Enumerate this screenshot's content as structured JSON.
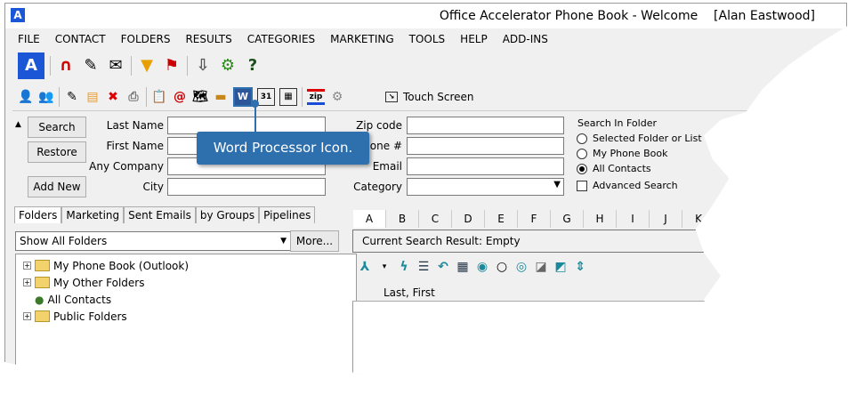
{
  "window": {
    "title": "Office Accelerator Phone Book - Welcome",
    "user": "[Alan Eastwood]"
  },
  "menu": [
    "FILE",
    "CONTACT",
    "FOLDERS",
    "RESULTS",
    "CATEGORIES",
    "MARKETING",
    "TOOLS",
    "HELP",
    "ADD-INS"
  ],
  "toolbar": {
    "touch_screen": "Touch Screen",
    "zip": "zip",
    "word": "W"
  },
  "search": {
    "search_btn": "Search",
    "restore_btn": "Restore",
    "add_new_btn": "Add New",
    "labels": {
      "last_name": "Last Name",
      "first_name": "First Name",
      "any_company": "Any Company",
      "city": "City",
      "zip": "Zip code",
      "phone": "Phone #",
      "email": "Email",
      "category": "Category"
    },
    "folder_title": "Search In Folder",
    "options": [
      "Selected Folder or List",
      "My Phone Book",
      "All Contacts"
    ],
    "selected": "All Contacts",
    "advanced": "Advanced Search"
  },
  "callout": "Word Processor Icon.",
  "left_tabs": [
    "Folders",
    "Marketing",
    "Sent Emails",
    "by Groups",
    "Pipelines"
  ],
  "folder_select": "Show All Folders",
  "more_btn": "More...",
  "tree": [
    "My Phone Book (Outlook)",
    "My Other Folders",
    "All Contacts",
    "Public Folders"
  ],
  "alpha": [
    "A",
    "B",
    "C",
    "D",
    "E",
    "F",
    "G",
    "H",
    "I",
    "J",
    "K"
  ],
  "result": "Current Search Result: Empty",
  "column": "Last, First"
}
